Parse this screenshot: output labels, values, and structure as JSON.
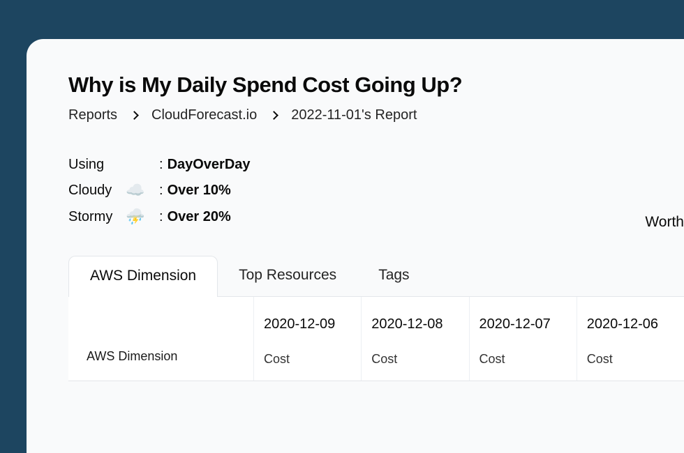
{
  "page": {
    "title": "Why is My Daily Spend Cost Going Up?"
  },
  "breadcrumb": {
    "items": [
      "Reports",
      "CloudForecast.io",
      "2022-11-01's Report"
    ]
  },
  "legend": {
    "using": {
      "label": "Using",
      "value": "DayOverDay"
    },
    "cloudy": {
      "label": "Cloudy",
      "icon": "☁️",
      "value": "Over 10%"
    },
    "stormy": {
      "label": "Stormy",
      "icon": "⛈️",
      "value": "Over 20%"
    }
  },
  "rightLabel": "Worth",
  "tabs": {
    "items": [
      {
        "label": "AWS Dimension",
        "active": true
      },
      {
        "label": "Top Resources",
        "active": false
      },
      {
        "label": "Tags",
        "active": false
      }
    ]
  },
  "table": {
    "rowHeader": "AWS Dimension",
    "costLabel": "Cost",
    "columns": [
      "2020-12-09",
      "2020-12-08",
      "2020-12-07",
      "2020-12-06"
    ]
  }
}
